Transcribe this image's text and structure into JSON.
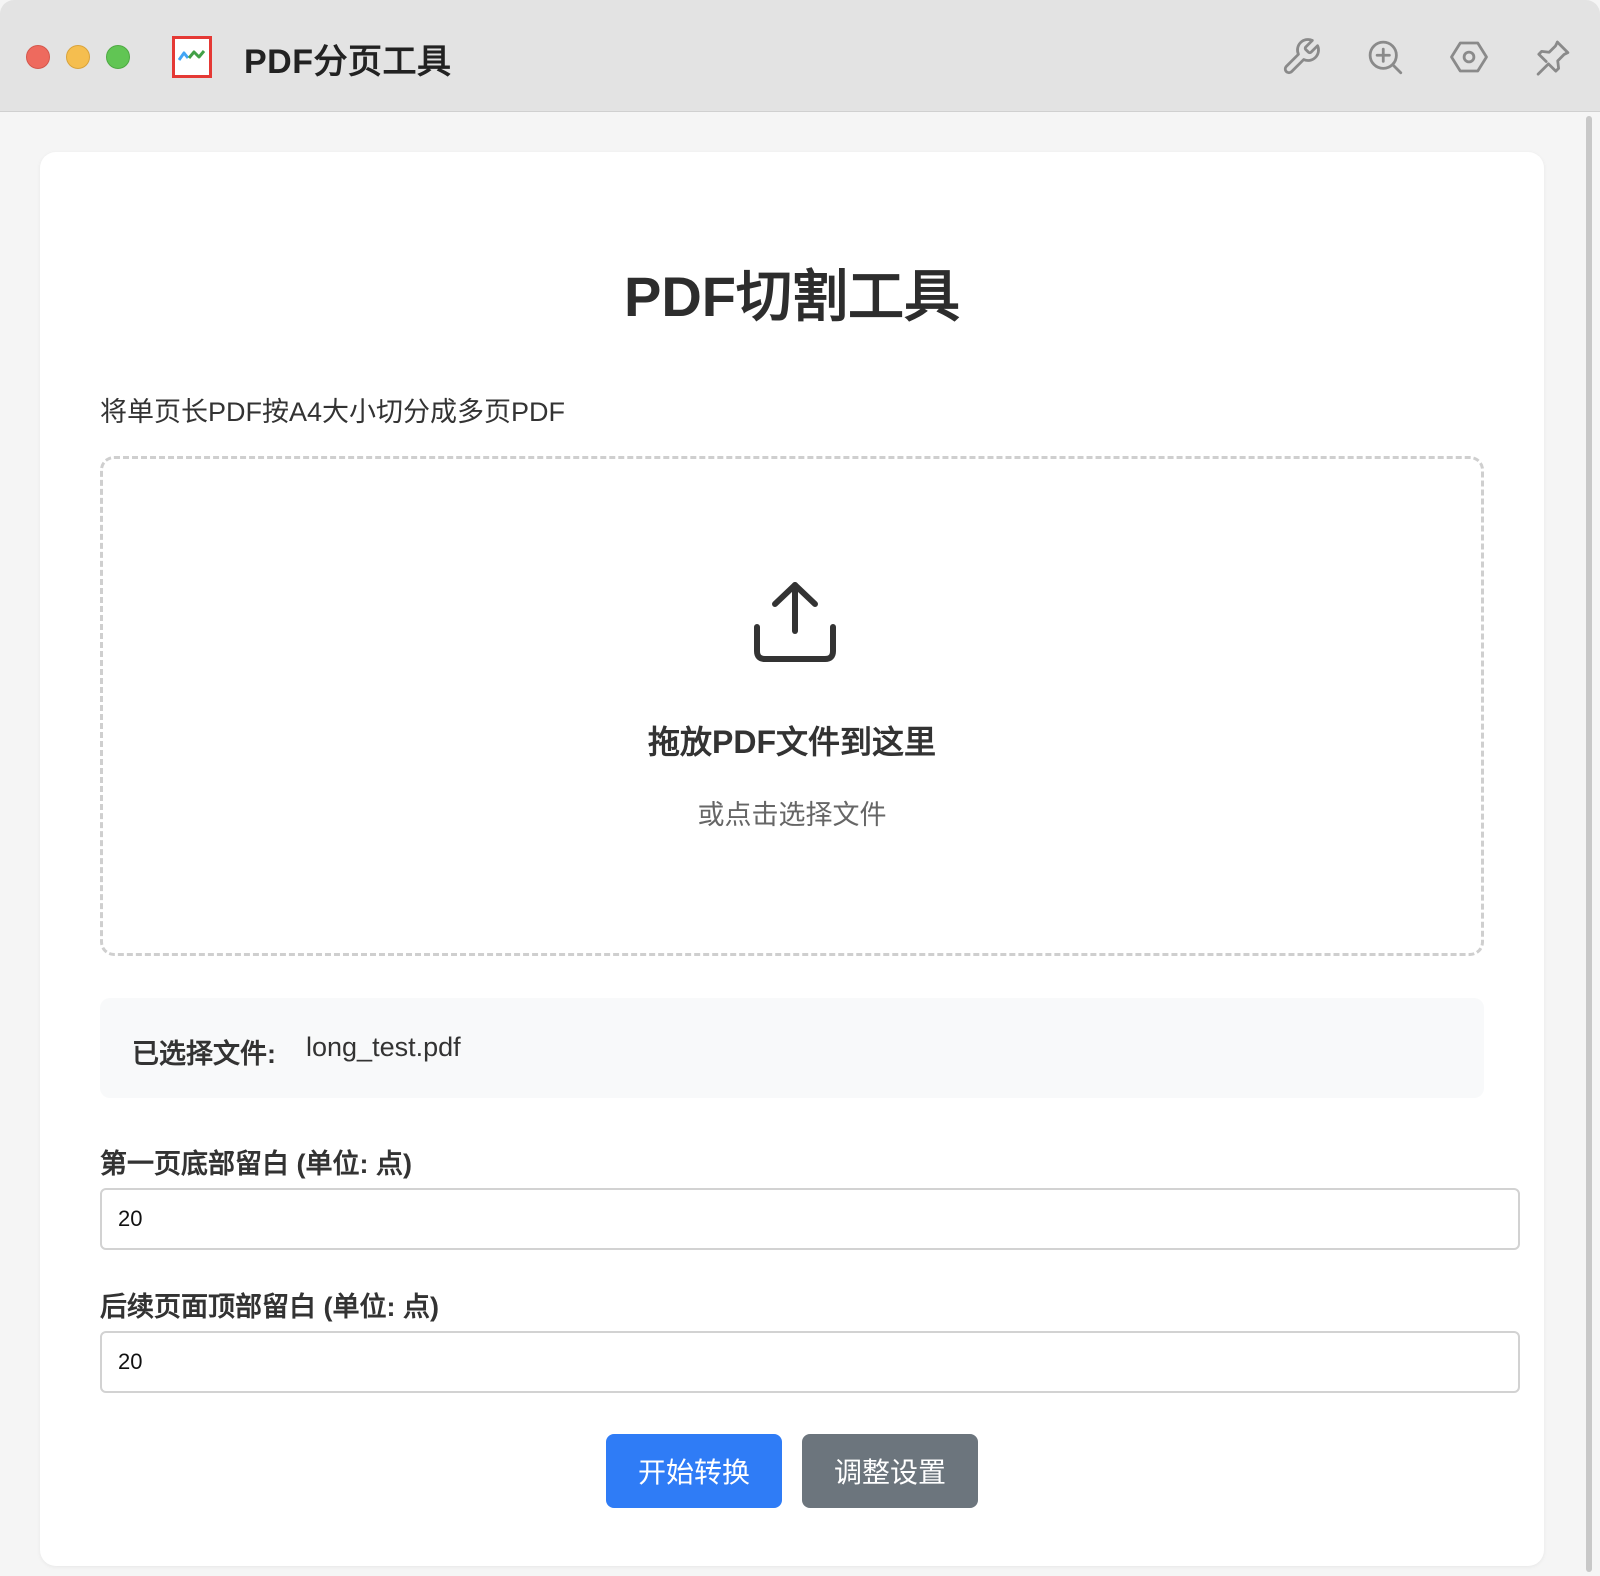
{
  "window": {
    "title": "PDF分页工具",
    "toolbar_icons": [
      "wrench-icon",
      "zoom-in-icon",
      "hexagon-settings-icon",
      "pin-icon"
    ]
  },
  "main": {
    "heading": "PDF切割工具",
    "description": "将单页长PDF按A4大小切分成多页PDF",
    "dropzone": {
      "icon": "upload-icon",
      "title": "拖放PDF文件到这里",
      "subtitle": "或点击选择文件"
    },
    "file_info": {
      "label": "已选择文件:",
      "filename": "long_test.pdf"
    },
    "fields": [
      {
        "label": "第一页底部留白 (单位: 点)",
        "value": "20"
      },
      {
        "label": "后续页面顶部留白 (单位: 点)",
        "value": "20"
      }
    ],
    "buttons": {
      "start": "开始转换",
      "settings": "调整设置"
    }
  },
  "colors": {
    "primary_button": "#2f7cf6",
    "secondary_button": "#6c757d",
    "close": "#ee6a5e",
    "minimize": "#f5be4f",
    "zoom": "#61c554"
  }
}
